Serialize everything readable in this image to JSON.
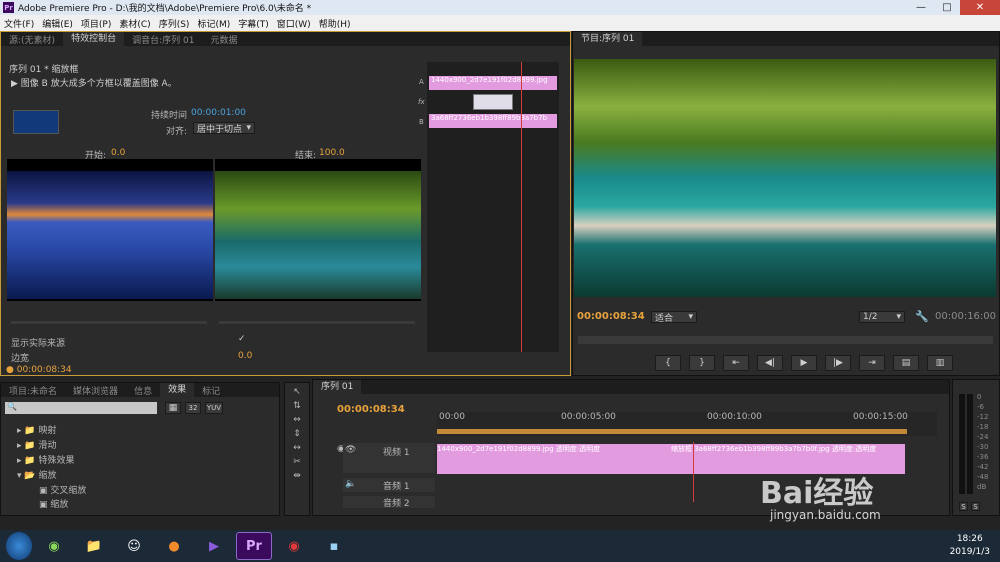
{
  "app": {
    "title": "Adobe Premiere Pro - D:\\我的文档\\Adobe\\Premiere Pro\\6.0\\未命名 *",
    "logo": "Pr"
  },
  "menu": [
    "文件(F)",
    "编辑(E)",
    "项目(P)",
    "素材(C)",
    "序列(S)",
    "标记(M)",
    "字幕(T)",
    "窗口(W)",
    "帮助(H)"
  ],
  "left_tabs": [
    "源:(无素材)",
    "特效控制台",
    "调音台:序列 01",
    "元数据"
  ],
  "effect_controls": {
    "header": "序列 01 * 缩放框",
    "description": "图像 B 放大成多个方框以覆盖图像 A。",
    "duration_label": "持续时间",
    "duration_value": "00:00:01:00",
    "align_label": "对齐:",
    "align_value": "居中于切点",
    "start_label": "开始:",
    "start_value": "0.0",
    "end_label": "结束:",
    "end_value": "100.0",
    "show_source_label": "显示实际来源",
    "border_label": "边宽",
    "border_value": "0.0",
    "timecode": "00:00:08:34",
    "mini_clip_a": "1440x900_2d7e191f02d8899.jpg",
    "mini_clip_b": "3a68ff2736eb1b398ff89b3a7b7b",
    "track_a": "A",
    "track_b": "B",
    "fx": "fx"
  },
  "program": {
    "tab": "节目:序列 01",
    "timecode": "00:00:08:34",
    "fit": "适合",
    "res": "1/2",
    "duration": "00:00:16:00"
  },
  "project_tabs": [
    "项目:未命名",
    "媒体浏览器",
    "信息",
    "效果",
    "标记"
  ],
  "effects_tree": [
    {
      "label": "映射",
      "level": 1,
      "icon": "folder"
    },
    {
      "label": "滑动",
      "level": 1,
      "icon": "folder"
    },
    {
      "label": "特殊效果",
      "level": 1,
      "icon": "folder"
    },
    {
      "label": "缩放",
      "level": 1,
      "icon": "folder",
      "open": true
    },
    {
      "label": "交叉缩放",
      "level": 2,
      "icon": "effect"
    },
    {
      "label": "缩放",
      "level": 2,
      "icon": "effect"
    }
  ],
  "effects_search_btns": [
    "32",
    "YUV"
  ],
  "timeline": {
    "tab": "序列 01",
    "timecode": "00:00:08:34",
    "ruler": [
      "00:00",
      "00:00:05:00",
      "00:00:10:00",
      "00:00:15:00"
    ],
    "video_track": "视频 1",
    "audio_track1": "音频 1",
    "audio_track2": "音频 2",
    "clip1": "1440x900_2d7e191f02d8899.jpg 透明度:透明度",
    "clip2": "缩放框 3a68ff2736eb1b398ff89b3a7b7b0f.jpg 透明度:透明度"
  },
  "meter": {
    "labels": [
      "0",
      "-6",
      "-12",
      "-18",
      "-24",
      "-30",
      "-36",
      "-42",
      "-48",
      "-54",
      "dB"
    ],
    "solo": [
      "S",
      "S"
    ]
  },
  "taskbar": {
    "time": "18:26",
    "date": "2019/1/3"
  },
  "watermark": {
    "brand": "Bai经验",
    "url": "jingyan.baidu.com"
  }
}
